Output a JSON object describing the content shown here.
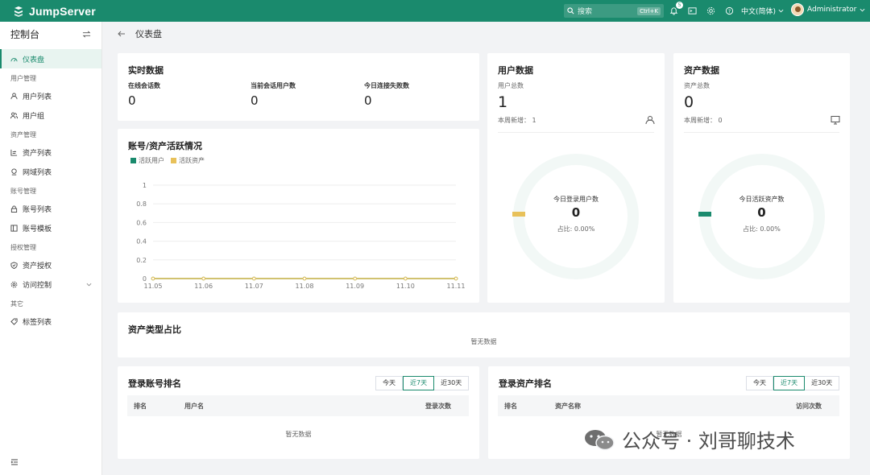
{
  "app": {
    "name": "JumpServer"
  },
  "topbar": {
    "search_placeholder": "搜索",
    "search_shortcut": "Ctrl+K",
    "notification_count": "5",
    "language": "中文(简体)",
    "username": "Administrator",
    "accent": "#1a8a6d"
  },
  "sidebar": {
    "title": "控制台",
    "active": "仪表盘",
    "groups": [
      {
        "label": "用户管理",
        "items": [
          "用户列表",
          "用户组"
        ]
      },
      {
        "label": "资产管理",
        "items": [
          "资产列表",
          "网域列表"
        ]
      },
      {
        "label": "账号管理",
        "items": [
          "账号列表",
          "账号模板"
        ]
      },
      {
        "label": "授权管理",
        "items": [
          "资产授权",
          "访问控制"
        ]
      },
      {
        "label": "其它",
        "items": [
          "标签列表"
        ]
      }
    ]
  },
  "breadcrumb": {
    "title": "仪表盘"
  },
  "realtime": {
    "title": "实时数据",
    "metrics": [
      {
        "label": "在线会话数",
        "value": "0"
      },
      {
        "label": "当前会话用户数",
        "value": "0"
      },
      {
        "label": "今日连接失败数",
        "value": "0"
      }
    ]
  },
  "activity": {
    "title": "账号/资产活跃情况",
    "legend": [
      "活跃用户",
      "活跃资产"
    ]
  },
  "chart_data": {
    "type": "line",
    "categories": [
      "11.05",
      "11.06",
      "11.07",
      "11.08",
      "11.09",
      "11.10",
      "11.11"
    ],
    "series": [
      {
        "name": "活跃用户",
        "values": [
          0,
          0,
          0,
          0,
          0,
          0,
          0
        ],
        "color": "#1a8a6d"
      },
      {
        "name": "活跃资产",
        "values": [
          0,
          0,
          0,
          0,
          0,
          0,
          0
        ],
        "color": "#e8c15a"
      }
    ],
    "yticks": [
      "0",
      "0.2",
      "0.4",
      "0.6",
      "0.8",
      "1"
    ],
    "ylim": [
      0,
      1
    ],
    "grid": true,
    "legend": "top-left"
  },
  "user_data": {
    "title": "用户数据",
    "total_label": "用户总数",
    "total": "1",
    "weekly_label": "本周新增：",
    "weekly": "1",
    "donut_label": "今日登录用户数",
    "donut_value": "0",
    "donut_ratio": "占比: 0.00%"
  },
  "asset_data": {
    "title": "资产数据",
    "total_label": "资产总数",
    "total": "0",
    "weekly_label": "本周新增：",
    "weekly": "0",
    "donut_label": "今日活跃资产数",
    "donut_value": "0",
    "donut_ratio": "占比: 0.00%"
  },
  "asset_types": {
    "title": "资产类型占比",
    "empty": "暂无数据"
  },
  "account_rank": {
    "title": "登录账号排名",
    "tabs": [
      "今天",
      "近7天",
      "近30天"
    ],
    "active_tab": "近7天",
    "columns": [
      "排名",
      "用户名",
      "登录次数"
    ],
    "empty": "暂无数据"
  },
  "asset_rank": {
    "title": "登录资产排名",
    "tabs": [
      "今天",
      "近7天",
      "近30天"
    ],
    "active_tab": "近7天",
    "columns": [
      "排名",
      "资产名称",
      "访问次数"
    ],
    "empty": "暂无数据"
  },
  "watermark": {
    "text": "公众号 · 刘哥聊技术"
  }
}
